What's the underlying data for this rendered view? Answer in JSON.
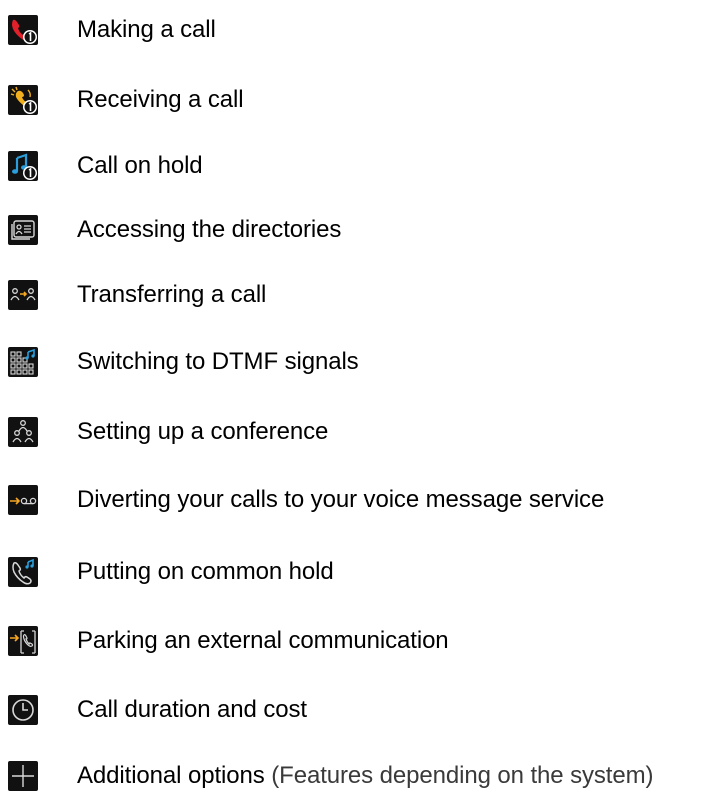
{
  "items": [
    {
      "icon": "phone-handset-badge-icon",
      "label": "Making a call"
    },
    {
      "icon": "ringing-phone-badge-icon",
      "label": "Receiving a call"
    },
    {
      "icon": "music-note-badge-icon",
      "label": "Call on hold"
    },
    {
      "icon": "directory-card-icon",
      "label": "Accessing the directories"
    },
    {
      "icon": "transfer-users-icon",
      "label": "Transferring a call"
    },
    {
      "icon": "keypad-music-icon",
      "label": "Switching to DTMF signals"
    },
    {
      "icon": "conference-users-icon",
      "label": "Setting up a conference"
    },
    {
      "icon": "divert-voicemail-icon",
      "label": "Diverting your calls to your voice message service"
    },
    {
      "icon": "phone-music-icon",
      "label": "Putting on common hold"
    },
    {
      "icon": "park-call-icon",
      "label": "Parking an external communication"
    },
    {
      "icon": "clock-icon",
      "label": "Call duration and cost"
    },
    {
      "icon": "plus-icon",
      "label": "Additional options",
      "note": "(Features depending on the system)"
    }
  ],
  "colors": {
    "tile": "#111111",
    "red": "#e0202a",
    "amber": "#f2b01e",
    "blue": "#2a9fdc",
    "orange": "#f5a623",
    "icon_line": "#d8d8d8"
  }
}
